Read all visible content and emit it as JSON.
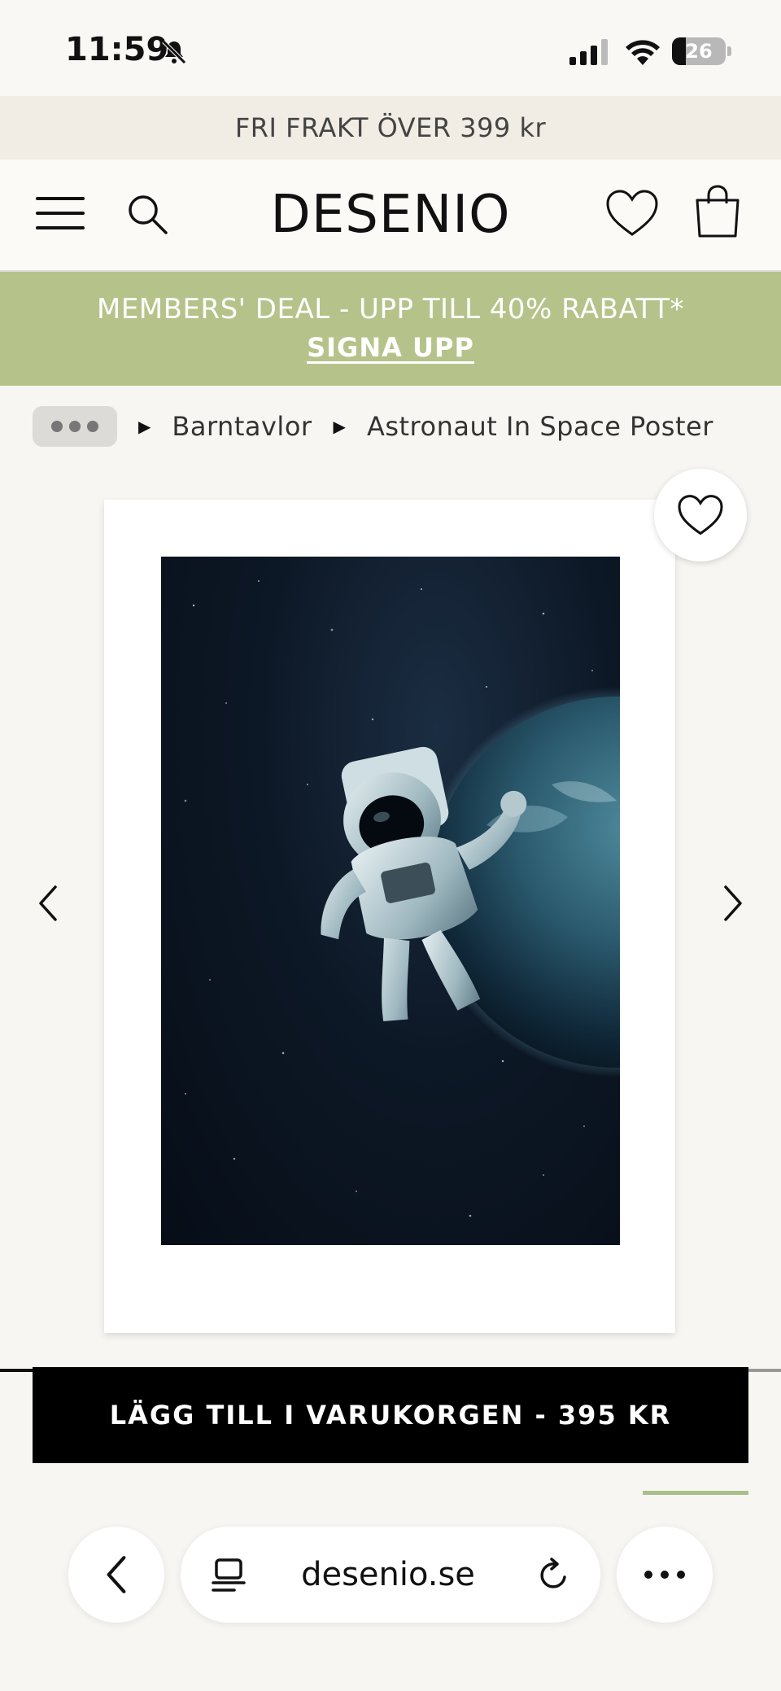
{
  "status_bar": {
    "time": "11:59",
    "battery": "26",
    "battery_level": 0.26
  },
  "shipping_banner": {
    "text": "FRI FRAKT ÖVER 399 kr"
  },
  "header": {
    "logo": "DESENIO",
    "icons": [
      "menu-icon",
      "search-icon",
      "heart-icon",
      "bag-icon"
    ]
  },
  "deal_banner": {
    "text": "MEMBERS' DEAL - UPP TILL 40% RABATT*",
    "link": "SIGNA UPP",
    "color": "#b5c38a"
  },
  "breadcrumb": {
    "items": [
      "Barntavlor",
      "Astronaut In Space Poster"
    ]
  },
  "product": {
    "image_icon": "astronaut-in-space-image"
  },
  "cta": {
    "label": "LÄGG TILL I VARUKORGEN - 395 KR"
  },
  "browser": {
    "url": "desenio.se"
  }
}
